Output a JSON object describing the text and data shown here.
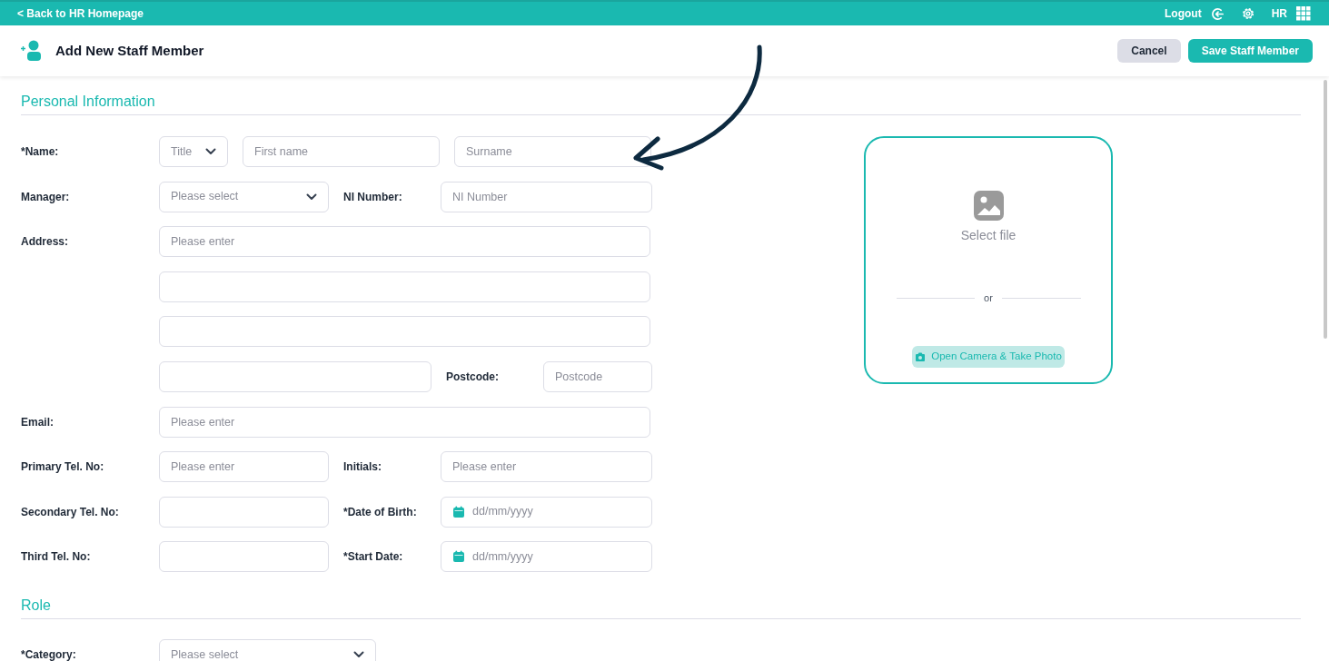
{
  "top_bar": {
    "back_link": "< Back to HR Homepage",
    "logout": "Logout",
    "user_initials": "HR"
  },
  "header": {
    "title": "Add New Staff Member",
    "cancel": "Cancel",
    "save": "Save Staff Member"
  },
  "personal": {
    "heading": "Personal Information",
    "rows": [
      {
        "kind": "name",
        "label": "*Name:",
        "fields": [
          {
            "kind": "select",
            "placeholder": "Title"
          },
          {
            "kind": "text",
            "placeholder": "First name"
          },
          {
            "kind": "text",
            "placeholder": "Surname"
          }
        ]
      },
      {
        "kind": "split",
        "label": "Manager:",
        "fields": [
          {
            "kind": "select",
            "placeholder": "Please select"
          },
          {
            "kind": "text",
            "placeholder": "NI Number"
          }
        ],
        "second_label": "NI Number:"
      },
      {
        "kind": "full",
        "label": "Address:",
        "fields": [
          {
            "kind": "text",
            "placeholder": "Please enter"
          }
        ]
      },
      {
        "kind": "full",
        "fields": [
          {
            "kind": "text"
          }
        ]
      },
      {
        "kind": "full",
        "fields": [
          {
            "kind": "text"
          }
        ]
      },
      {
        "kind": "postcode",
        "fields": [
          {
            "kind": "text"
          },
          {
            "kind": "text",
            "placeholder": "Postcode"
          }
        ],
        "second_label": "Postcode:"
      },
      {
        "kind": "full",
        "label": "Email:",
        "fields": [
          {
            "kind": "text",
            "placeholder": "Please enter"
          }
        ]
      },
      {
        "kind": "split",
        "label": "Primary Tel. No:",
        "fields": [
          {
            "kind": "text",
            "placeholder": "Please enter"
          },
          {
            "kind": "text",
            "placeholder": "Please enter"
          }
        ],
        "second_label": "Initials:"
      },
      {
        "kind": "split",
        "label": "Secondary Tel. No:",
        "fields": [
          {
            "kind": "text"
          },
          {
            "kind": "date",
            "placeholder": "dd/mm/yyyy"
          }
        ],
        "second_label": "*Date of Birth:"
      },
      {
        "kind": "split",
        "label": "Third Tel. No:",
        "fields": [
          {
            "kind": "text"
          },
          {
            "kind": "date",
            "placeholder": "dd/mm/yyyy"
          }
        ],
        "second_label": "*Start Date:"
      }
    ]
  },
  "photo": {
    "select_file": "Select file",
    "or": "or",
    "camera_button": "Open Camera & Take Photo"
  },
  "role": {
    "heading": "Role",
    "rows": [
      {
        "kind": "category",
        "label": "*Category:",
        "fields": [
          {
            "kind": "select",
            "placeholder": "Please select"
          }
        ]
      }
    ]
  }
}
